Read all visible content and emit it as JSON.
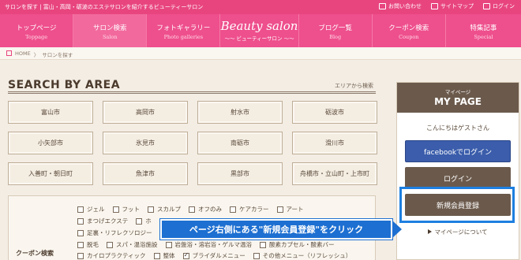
{
  "topbar": {
    "tagline": "サロンを探す | 富山・高岡・砺波のエステサロンを紹介するビューティーサロン",
    "links": [
      {
        "label": "お問い合わせ",
        "icon": "mail-icon"
      },
      {
        "label": "サイトマップ",
        "icon": "sitemap-icon"
      },
      {
        "label": "ログイン",
        "icon": "login-icon"
      }
    ]
  },
  "nav": {
    "items_left": [
      {
        "jp": "トップページ",
        "en": "Toppage"
      },
      {
        "jp": "サロン検索",
        "en": "Salon",
        "active": true
      },
      {
        "jp": "フォトギャラリー",
        "en": "Photo galleries"
      }
    ],
    "logo": {
      "main": "Beauty salon",
      "sub": "〜〜 ビューティーサロン 〜〜"
    },
    "items_right": [
      {
        "jp": "ブログ一覧",
        "en": "Blog"
      },
      {
        "jp": "クーポン検索",
        "en": "Coupon"
      },
      {
        "jp": "特集記事",
        "en": "Special"
      }
    ]
  },
  "breadcrumb": {
    "home": "HOME",
    "sep": "〉",
    "current": "サロンを探す"
  },
  "search": {
    "title": "SEARCH BY AREA",
    "link": "エリアから検索",
    "areas": [
      "富山市",
      "高岡市",
      "射水市",
      "砺波市",
      "小矢部市",
      "氷見市",
      "南砺市",
      "滑川市",
      "入善町・朝日町",
      "魚津市",
      "黒部市",
      "舟橋市・立山町・上市町"
    ]
  },
  "filters": {
    "label": "クーポン検索",
    "rows": [
      [
        "ジェル",
        "フット",
        "スカルプ",
        "オフのみ",
        "ケアカラー",
        "アート"
      ],
      [
        "まつげエクステ",
        "ホ"
      ],
      [
        "足裏・リフレクソロジー"
      ],
      [
        "脱毛",
        "スパ・温浴施設",
        "岩盤浴・溶岩浴・ゲルマ温浴",
        "酸素カプセル・酸素バー"
      ],
      [
        "カイロプラクティック",
        "整体",
        "ブライダルメニュー",
        "その他メニュー（リフレッシュ）"
      ]
    ],
    "checked": "ブライダルメニュー"
  },
  "mypage": {
    "small": "マイページ",
    "big": "MY PAGE",
    "greeting": "こんにちはゲストさん",
    "facebook_label": "facebookでログイン",
    "login_label": "ログイン",
    "register_label": "新規会員登録",
    "about_label": "マイページについて"
  },
  "annotation": {
    "callout_text": "ページ右側にある\"新規会員登録\"をクリック",
    "color": "#1d6fd1"
  }
}
